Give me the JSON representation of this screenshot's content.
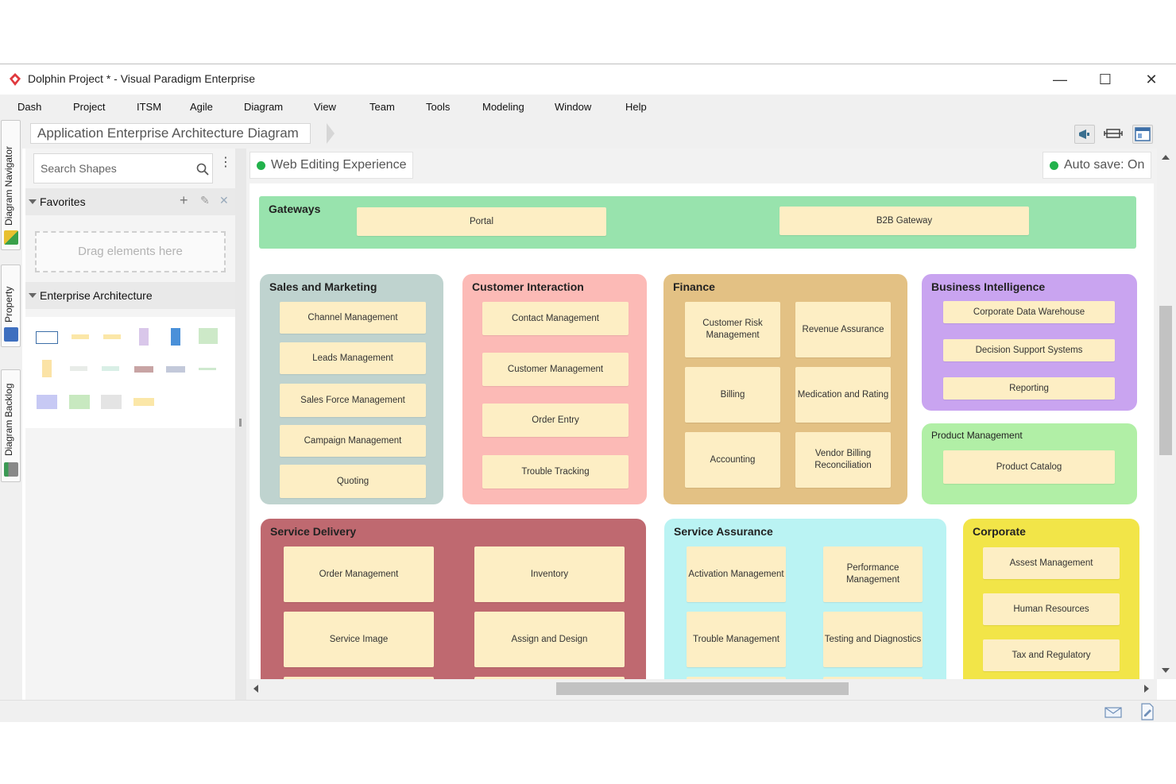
{
  "window": {
    "title": "Dolphin Project * - Visual Paradigm Enterprise"
  },
  "menu": [
    "Dash",
    "Project",
    "ITSM",
    "Agile",
    "Diagram",
    "View",
    "Team",
    "Tools",
    "Modeling",
    "Window",
    "Help"
  ],
  "rail": {
    "tabs": [
      "Diagram Navigator",
      "Property",
      "Diagram Backlog"
    ]
  },
  "breadcrumb": "Application Enterprise Architecture Diagram",
  "left_panel": {
    "search_placeholder": "Search Shapes",
    "favorites": {
      "title": "Favorites",
      "drop_hint": "Drag elements here"
    },
    "enterprise": {
      "title": "Enterprise Architecture"
    }
  },
  "canvas": {
    "web_editing": "Web Editing Experience",
    "auto_save": "Auto save: On"
  },
  "diagram": {
    "gateways": {
      "title": "Gateways",
      "items": [
        "Portal",
        "B2B Gateway"
      ]
    },
    "sales": {
      "title": "Sales and Marketing",
      "items": [
        "Channel Management",
        "Leads Management",
        "Sales Force Management",
        "Campaign Management",
        "Quoting"
      ]
    },
    "customer": {
      "title": "Customer Interaction",
      "items": [
        "Contact Management",
        "Customer Management",
        "Order Entry",
        "Trouble Tracking"
      ]
    },
    "finance": {
      "title": "Finance",
      "items": [
        "Customer Risk Management",
        "Revenue Assurance",
        "Billing",
        "Medication and Rating",
        "Accounting",
        "Vendor Billing Reconciliation"
      ]
    },
    "bi": {
      "title": "Business Intelligence",
      "items": [
        "Corporate Data Warehouse",
        "Decision Support Systems",
        "Reporting"
      ]
    },
    "product": {
      "title": "Product Management",
      "items": [
        "Product Catalog"
      ]
    },
    "delivery": {
      "title": "Service Delivery",
      "items": [
        "Order Management",
        "Inventory",
        "Service Image",
        "Assign and Design"
      ]
    },
    "assurance": {
      "title": "Service Assurance",
      "items": [
        "Activation Management",
        "Performance Management",
        "Trouble Management",
        "Testing and Diagnostics"
      ]
    },
    "corporate": {
      "title": "Corporate",
      "items": [
        "Assest Management",
        "Human Resources",
        "Tax and Regulatory"
      ]
    }
  },
  "colors": {
    "gateways": "#98e3ad",
    "sales": "#bfd3cf",
    "customer": "#fcbab6",
    "finance": "#e3c184",
    "bi": "#c9a4f0",
    "product": "#b1efa6",
    "delivery": "#bf6970",
    "assurance": "#baf3f3",
    "corporate": "#f2e548",
    "box": "#fdeec4",
    "status_dot": "#22b24c"
  }
}
